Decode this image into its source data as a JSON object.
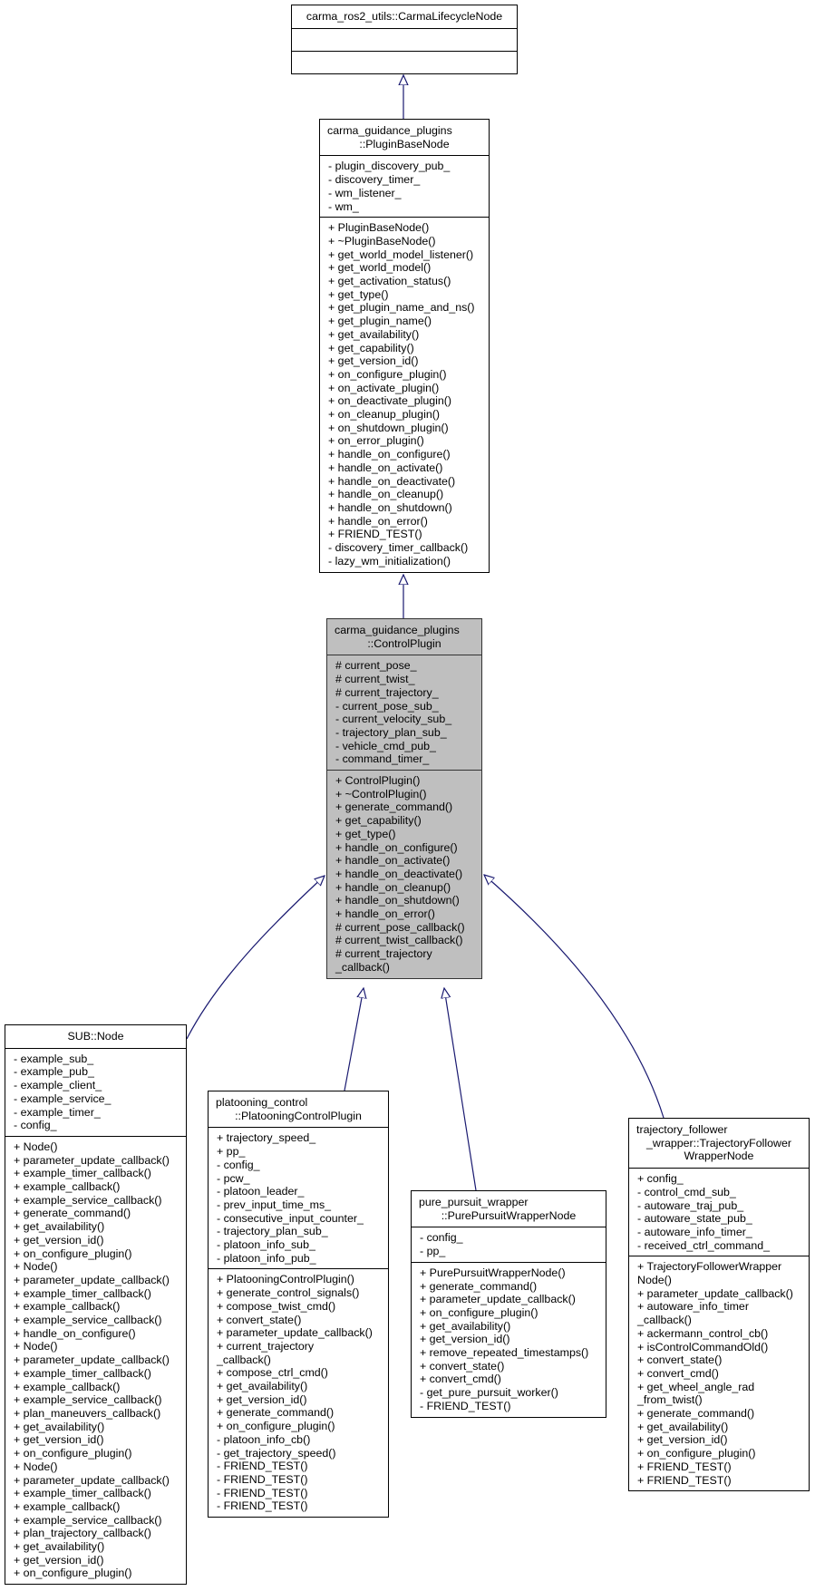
{
  "colors": {
    "edge": "#191970",
    "current_class_fill": "#bfbfbf",
    "box_fill": "#ffffff"
  },
  "classes": [
    {
      "id": "carma-lifecycle-node",
      "title": [
        "carma_ros2_utils::CarmaLifecycleNode"
      ],
      "attributes": [],
      "methods": []
    },
    {
      "id": "plugin-base-node",
      "title": [
        "carma_guidance_plugins",
        "::PluginBaseNode"
      ],
      "attributes": [
        "- plugin_discovery_pub_",
        "- discovery_timer_",
        "- wm_listener_",
        "- wm_"
      ],
      "methods": [
        "+ PluginBaseNode()",
        "+ ~PluginBaseNode()",
        "+ get_world_model_listener()",
        "+ get_world_model()",
        "+ get_activation_status()",
        "+ get_type()",
        "+ get_plugin_name_and_ns()",
        "+ get_plugin_name()",
        "+ get_availability()",
        "+ get_capability()",
        "+ get_version_id()",
        "+ on_configure_plugin()",
        "+ on_activate_plugin()",
        "+ on_deactivate_plugin()",
        "+ on_cleanup_plugin()",
        "+ on_shutdown_plugin()",
        "+ on_error_plugin()",
        "+ handle_on_configure()",
        "+ handle_on_activate()",
        "+ handle_on_deactivate()",
        "+ handle_on_cleanup()",
        "+ handle_on_shutdown()",
        "+ handle_on_error()",
        "+ FRIEND_TEST()",
        "- discovery_timer_callback()",
        "- lazy_wm_initialization()"
      ]
    },
    {
      "id": "control-plugin",
      "current": true,
      "title": [
        "carma_guidance_plugins",
        "::ControlPlugin"
      ],
      "attributes": [
        "# current_pose_",
        "# current_twist_",
        "# current_trajectory_",
        "- current_pose_sub_",
        "- current_velocity_sub_",
        "- trajectory_plan_sub_",
        "- vehicle_cmd_pub_",
        "- command_timer_"
      ],
      "methods": [
        "+ ControlPlugin()",
        "+ ~ControlPlugin()",
        "+ generate_command()",
        "+ get_capability()",
        "+ get_type()",
        "+ handle_on_configure()",
        "+ handle_on_activate()",
        "+ handle_on_deactivate()",
        "+ handle_on_cleanup()",
        "+ handle_on_shutdown()",
        "+ handle_on_error()",
        "# current_pose_callback()",
        "# current_twist_callback()",
        "# current_trajectory",
        "_callback()"
      ]
    },
    {
      "id": "sub-node",
      "title": [
        "SUB::Node"
      ],
      "center_title": true,
      "attributes": [
        "- example_sub_",
        "- example_pub_",
        "- example_client_",
        "- example_service_",
        "- example_timer_",
        "- config_"
      ],
      "methods": [
        "+ Node()",
        "+ parameter_update_callback()",
        "+ example_timer_callback()",
        "+ example_callback()",
        "+ example_service_callback()",
        "+ generate_command()",
        "+ get_availability()",
        "+ get_version_id()",
        "+ on_configure_plugin()",
        "+ Node()",
        "+ parameter_update_callback()",
        "+ example_timer_callback()",
        "+ example_callback()",
        "+ example_service_callback()",
        "+ handle_on_configure()",
        "+ Node()",
        "+ parameter_update_callback()",
        "+ example_timer_callback()",
        "+ example_callback()",
        "+ example_service_callback()",
        "+ plan_maneuvers_callback()",
        "+ get_availability()",
        "+ get_version_id()",
        "+ on_configure_plugin()",
        "+ Node()",
        "+ parameter_update_callback()",
        "+ example_timer_callback()",
        "+ example_callback()",
        "+ example_service_callback()",
        "+ plan_trajectory_callback()",
        "+ get_availability()",
        "+ get_version_id()",
        "+ on_configure_plugin()"
      ]
    },
    {
      "id": "platooning-control-plugin",
      "title": [
        "platooning_control",
        "::PlatooningControlPlugin"
      ],
      "attributes": [
        "+ trajectory_speed_",
        "+ pp_",
        "- config_",
        "- pcw_",
        "- platoon_leader_",
        "- prev_input_time_ms_",
        "- consecutive_input_counter_",
        "- trajectory_plan_sub_",
        "- platoon_info_sub_",
        "- platoon_info_pub_"
      ],
      "methods": [
        "+ PlatooningControlPlugin()",
        "+ generate_control_signals()",
        "+ compose_twist_cmd()",
        "+ convert_state()",
        "+ parameter_update_callback()",
        "+ current_trajectory",
        "_callback()",
        "+ compose_ctrl_cmd()",
        "+ get_availability()",
        "+ get_version_id()",
        "+ generate_command()",
        "+ on_configure_plugin()",
        "- platoon_info_cb()",
        "- get_trajectory_speed()",
        "- FRIEND_TEST()",
        "- FRIEND_TEST()",
        "- FRIEND_TEST()",
        "- FRIEND_TEST()"
      ]
    },
    {
      "id": "pure-pursuit-wrapper-node",
      "title": [
        "pure_pursuit_wrapper",
        "::PurePursuitWrapperNode"
      ],
      "attributes": [
        "- config_",
        "- pp_"
      ],
      "methods": [
        "+ PurePursuitWrapperNode()",
        "+ generate_command()",
        "+ parameter_update_callback()",
        "+ on_configure_plugin()",
        "+ get_availability()",
        "+ get_version_id()",
        "+ remove_repeated_timestamps()",
        "+ convert_state()",
        "+ convert_cmd()",
        "- get_pure_pursuit_worker()",
        "- FRIEND_TEST()"
      ]
    },
    {
      "id": "trajectory-follower-wrapper-node",
      "title": [
        "trajectory_follower",
        "_wrapper::TrajectoryFollower",
        "WrapperNode"
      ],
      "attributes": [
        "+ config_",
        "- control_cmd_sub_",
        "- autoware_traj_pub_",
        "- autoware_state_pub_",
        "- autoware_info_timer_",
        "- received_ctrl_command_"
      ],
      "methods": [
        "+ TrajectoryFollowerWrapper",
        "Node()",
        "+ parameter_update_callback()",
        "+ autoware_info_timer",
        "_callback()",
        "+ ackermann_control_cb()",
        "+ isControlCommandOld()",
        "+ convert_state()",
        "+ convert_cmd()",
        "+ get_wheel_angle_rad",
        "_from_twist()",
        "+ generate_command()",
        "+ get_availability()",
        "+ get_version_id()",
        "+ on_configure_plugin()",
        "+ FRIEND_TEST()",
        "+ FRIEND_TEST()"
      ]
    }
  ],
  "inheritance": [
    {
      "child": "plugin-base-node",
      "parent": "carma-lifecycle-node"
    },
    {
      "child": "control-plugin",
      "parent": "plugin-base-node"
    },
    {
      "child": "sub-node",
      "parent": "control-plugin"
    },
    {
      "child": "platooning-control-plugin",
      "parent": "control-plugin"
    },
    {
      "child": "pure-pursuit-wrapper-node",
      "parent": "control-plugin"
    },
    {
      "child": "trajectory-follower-wrapper-node",
      "parent": "control-plugin"
    }
  ]
}
